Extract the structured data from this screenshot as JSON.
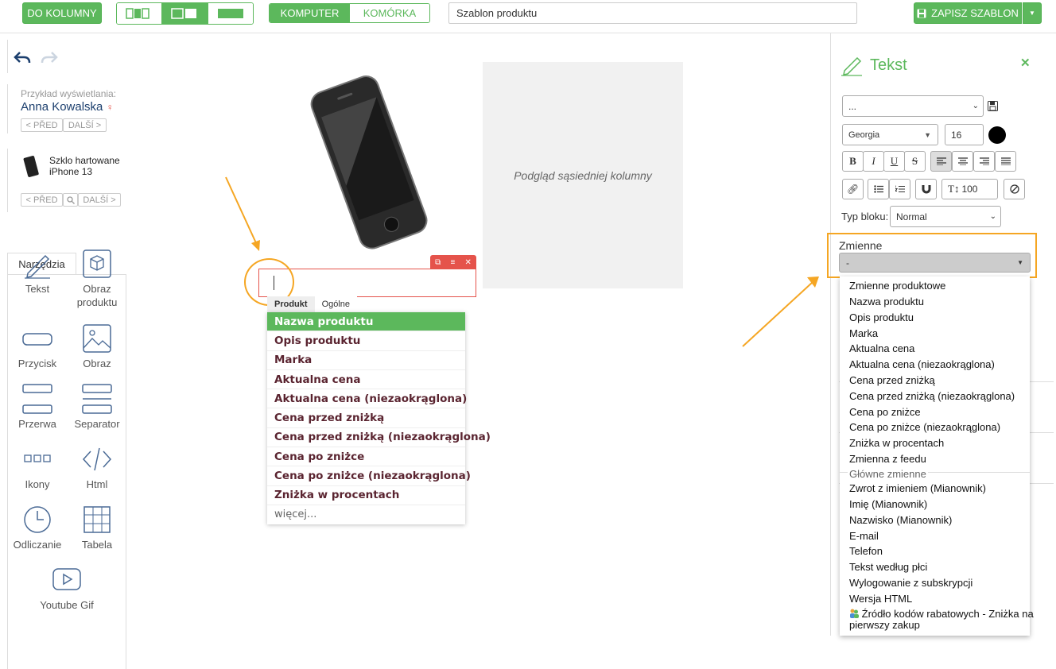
{
  "toolbar": {
    "to_columns": "DO KOLUMNY",
    "device_computer": "KOMPUTER",
    "device_cell": "KOMÓRKA",
    "template_name": "Szablon produktu",
    "save_template": "ZAPISZ SZABLON"
  },
  "preview_customer": {
    "label": "Przykład wyświetlania:",
    "name": "Anna Kowalska",
    "prev": "< PŘED",
    "next": "DALŠÍ >"
  },
  "preview_product": {
    "name_line1": "Szklo hartowane",
    "name_line2": "iPhone 13",
    "prev": "< PŘED",
    "next": "DALŠÍ >"
  },
  "tools": {
    "tab_label": "Narzędzia",
    "items": [
      {
        "label": "Tekst",
        "icon": "pencil-icon"
      },
      {
        "label": "Obraz produktu",
        "icon": "product-image-icon"
      },
      {
        "label": "Przycisk",
        "icon": "button-icon"
      },
      {
        "label": "Obraz",
        "icon": "image-icon"
      },
      {
        "label": "Przerwa",
        "icon": "spacer-icon"
      },
      {
        "label": "Separator",
        "icon": "separator-icon"
      },
      {
        "label": "Ikony",
        "icon": "icons-icon"
      },
      {
        "label": "Html",
        "icon": "code-icon"
      },
      {
        "label": "Odliczanie",
        "icon": "clock-icon"
      },
      {
        "label": "Tabela",
        "icon": "table-icon"
      },
      {
        "label": "Youtube Gif",
        "icon": "youtube-icon"
      }
    ]
  },
  "canvas": {
    "neighbor_preview": "Podgląd sąsiedniej kolumny"
  },
  "inline_dropdown": {
    "tab_product": "Produkt",
    "tab_general": "Ogólne",
    "items": [
      "Nazwa produktu",
      "Opis produktu",
      "Marka",
      "Aktualna cena",
      "Aktualna cena (niezaokrąglona)",
      "Cena przed zniżką",
      "Cena przed zniżką (niezaokrąglona)",
      "Cena po zniżce",
      "Cena po zniżce (niezaokrąglona)",
      "Zniżka w procentach"
    ],
    "more": "więcej..."
  },
  "panel": {
    "title": "Tekst",
    "style_select": "...",
    "font_family": "Georgia",
    "font_size": "16",
    "font_color": "#000000",
    "line_height": "100",
    "block_type_label": "Typ bloku:",
    "block_type_value": "Normal",
    "variables_label": "Zmienne",
    "variables_value": "-",
    "variables_options": [
      {
        "text": "Zmienne produktowe",
        "group": false
      },
      {
        "text": "Nazwa produktu",
        "group": false
      },
      {
        "text": "Opis produktu",
        "group": false
      },
      {
        "text": "Marka",
        "group": false
      },
      {
        "text": "Aktualna cena",
        "group": false
      },
      {
        "text": "Aktualna cena (niezaokrąglona)",
        "group": false
      },
      {
        "text": "Cena przed zniżką",
        "group": false
      },
      {
        "text": "Cena przed zniżką (niezaokrąglona)",
        "group": false
      },
      {
        "text": "Cena po zniżce",
        "group": false
      },
      {
        "text": "Cena po zniżce (niezaokrąglona)",
        "group": false
      },
      {
        "text": "Zniżka w procentach",
        "group": false
      },
      {
        "text": "Zmienna z feedu",
        "group": false
      },
      {
        "text": "Główne zmienne",
        "group": true
      },
      {
        "text": "Zwrot z imieniem (Mianownik)",
        "group": false
      },
      {
        "text": "Imię (Mianownik)",
        "group": false
      },
      {
        "text": "Nazwisko (Mianownik)",
        "group": false
      },
      {
        "text": "E-mail",
        "group": false
      },
      {
        "text": "Telefon",
        "group": false
      },
      {
        "text": "Tekst według płci",
        "group": false
      },
      {
        "text": "Wylogowanie z subskrypcji",
        "group": false
      },
      {
        "text": "Wersja HTML",
        "group": false
      }
    ],
    "discount_source_line1": "Źródło kodów rabatowych - Zniżka na",
    "discount_source_line2": "pierwszy zakup"
  },
  "colors": {
    "accent_green": "#5cb85c",
    "highlight_orange": "#f5a623",
    "selection_red": "#e5534b",
    "variable_text": "#5a2430"
  }
}
